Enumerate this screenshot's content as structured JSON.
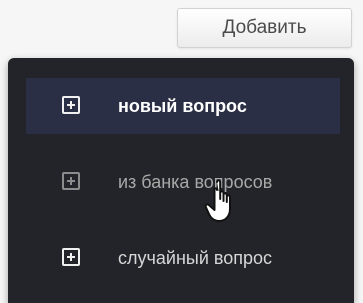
{
  "toolbar": {
    "add_button_label": "Добавить"
  },
  "menu": {
    "items": [
      {
        "label": "новый вопрос",
        "state": "active"
      },
      {
        "label": "из банка вопросов",
        "state": "hover"
      },
      {
        "label": "случайный вопрос",
        "state": "normal"
      }
    ]
  },
  "colors": {
    "page_background": "#f6f6f6",
    "menu_background": "#222429",
    "active_item_background": "#2b2f45",
    "text_light": "#d7d7d7",
    "text_muted": "#a9a9a9"
  },
  "icons": {
    "menu_item_icon": "plus-square-icon",
    "pointer_icon": "hand-cursor-icon"
  }
}
